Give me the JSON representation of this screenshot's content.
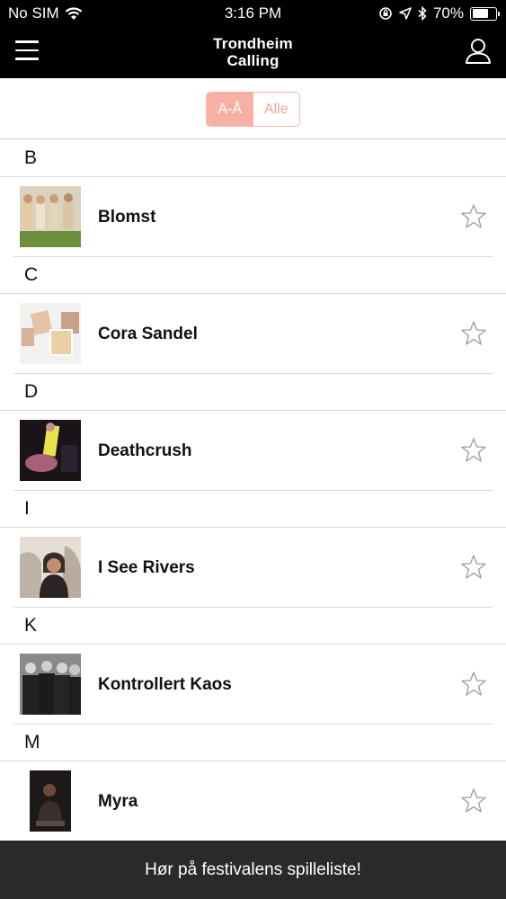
{
  "status_bar": {
    "carrier": "No SIM",
    "time": "3:16 PM",
    "battery_text": "70%",
    "battery_level": 0.7
  },
  "nav": {
    "title_line1": "Trondheim",
    "title_line2": "Calling",
    "menu_icon": "hamburger-menu-icon",
    "profile_icon": "user-profile-icon"
  },
  "segment": {
    "options": [
      "A-Å",
      "Alle"
    ],
    "selected": "A-Å",
    "active_color": "#f7b1a4"
  },
  "sections": [
    {
      "letter": "B",
      "artists": [
        {
          "name": "Blomst"
        }
      ]
    },
    {
      "letter": "C",
      "artists": [
        {
          "name": "Cora Sandel"
        }
      ]
    },
    {
      "letter": "D",
      "artists": [
        {
          "name": "Deathcrush"
        }
      ]
    },
    {
      "letter": "I",
      "artists": [
        {
          "name": "I See Rivers"
        }
      ]
    },
    {
      "letter": "K",
      "artists": [
        {
          "name": "Kontrollert Kaos"
        }
      ]
    },
    {
      "letter": "M",
      "artists": [
        {
          "name": "Myra"
        }
      ]
    }
  ],
  "bottom_bar": {
    "label": "Hør på festivalens spilleliste!"
  }
}
